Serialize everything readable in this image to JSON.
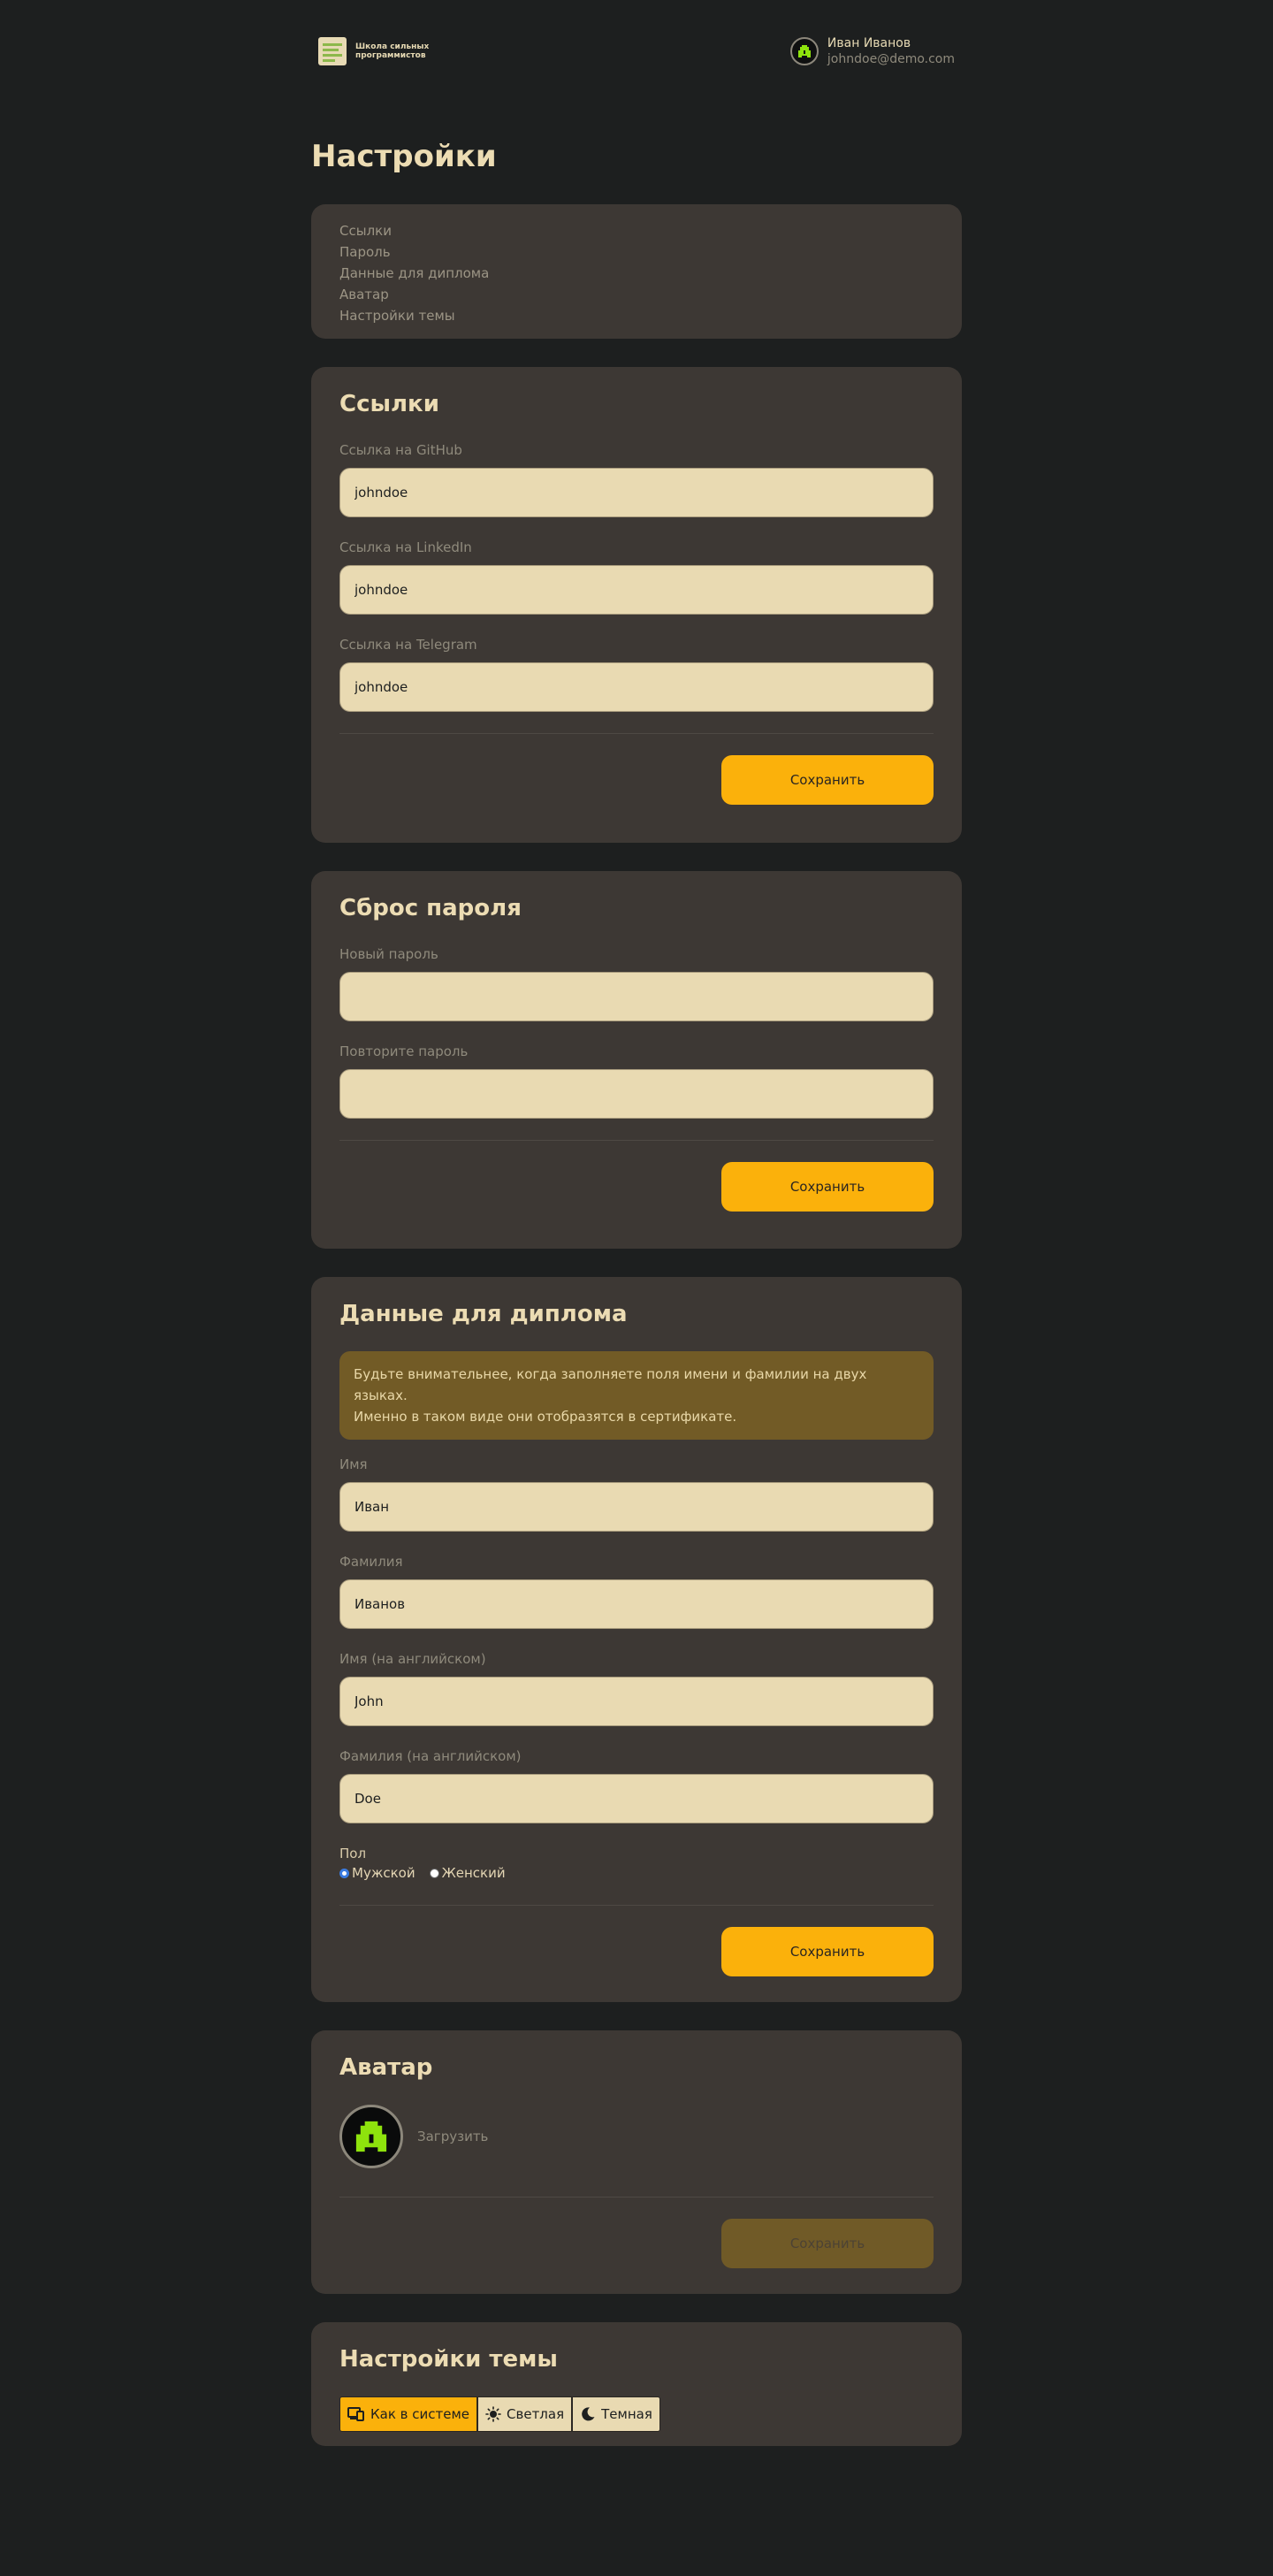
{
  "header": {
    "logo_text": "Школа сильных программистов",
    "user_name": "Иван Иванов",
    "user_email": "johndoe@demo.com"
  },
  "page_title": "Настройки",
  "nav": [
    "Ссылки",
    "Пароль",
    "Данные для диплома",
    "Аватар",
    "Настройки темы"
  ],
  "links": {
    "title": "Ссылки",
    "github_label": "Ссылка на GitHub",
    "github_value": "johndoe",
    "linkedin_label": "Ссылка на LinkedIn",
    "linkedin_value": "johndoe",
    "telegram_label": "Ссылка на Telegram",
    "telegram_value": "johndoe",
    "save": "Сохранить"
  },
  "password": {
    "title": "Сброс пароля",
    "new_label": "Новый пароль",
    "repeat_label": "Повторите пароль",
    "save": "Сохранить"
  },
  "diploma": {
    "title": "Данные для диплома",
    "notice_line1": "Будьте внимательнее, когда заполняете поля имени и фамилии на двух языках.",
    "notice_line2": "Именно в таком виде они отобразятся в сертификате.",
    "first_name_label": "Имя",
    "first_name_value": "Иван",
    "last_name_label": "Фамилия",
    "last_name_value": "Иванов",
    "first_name_en_label": "Имя (на английском)",
    "first_name_en_value": "John",
    "last_name_en_label": "Фамилия (на английском)",
    "last_name_en_value": "Doe",
    "gender_label": "Пол",
    "gender_male": "Мужской",
    "gender_female": "Женский",
    "gender_selected": "male",
    "save": "Сохранить"
  },
  "avatar": {
    "title": "Аватар",
    "upload": "Загрузить",
    "save": "Сохранить"
  },
  "theme": {
    "title": "Настройки темы",
    "system": "Как в системе",
    "light": "Светлая",
    "dark": "Темная",
    "selected": "system"
  },
  "colors": {
    "background": "#1d1f1f",
    "card": "#3d3834",
    "accent": "#fbb10b",
    "input": "#e9dab2",
    "notice": "#725b26",
    "avatar_green": "#8ee30d"
  }
}
